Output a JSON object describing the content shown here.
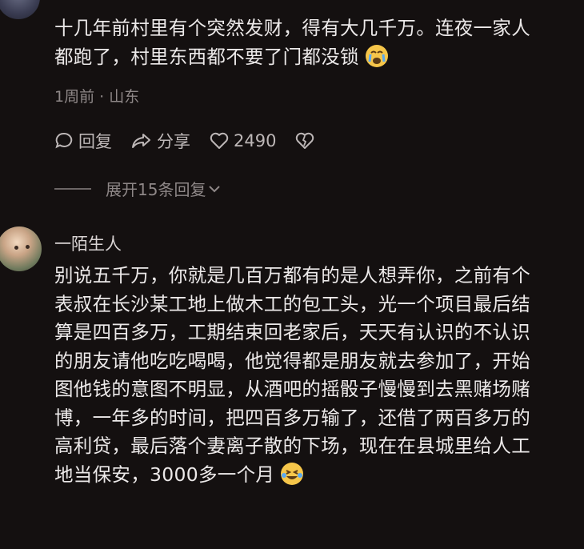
{
  "comments": [
    {
      "username": "",
      "text_lines": [
        "十几年前村里有个突然发财，得有大几千万。连夜一家人",
        "都跑了，村里东西都不要了门都没锁"
      ],
      "emoji": "crying-face-icon",
      "meta": "1周前 · 山东",
      "reply_label": "回复",
      "share_label": "分享",
      "like_count": "2490",
      "expand_label": "展开15条回复"
    },
    {
      "username": "一陌生人",
      "text_lines": [
        "别说五千万，你就是几百万都有的是人想弄你，之前有个",
        "表叔在长沙某工地上做木工的包工头，光一个项目最后结",
        "算是四百多万，工期结束回老家后，天天有认识的不认识",
        "的朋友请他吃吃喝喝，他觉得都是朋友就去参加了，开始",
        "图他钱的意图不明显，从酒吧的摇骰子慢慢到去黑赌场赌",
        "博，一年多的时间，把四百多万输了，还借了两百多万的",
        "高利贷，最后落个妻离子散的下场，现在在县城里给人工",
        "地当保安，3000多一个月"
      ],
      "emoji": "laughing-tears-icon"
    }
  ],
  "colors": {
    "background": "#141010",
    "text": "#ece9e9",
    "meta": "#8e8787"
  }
}
